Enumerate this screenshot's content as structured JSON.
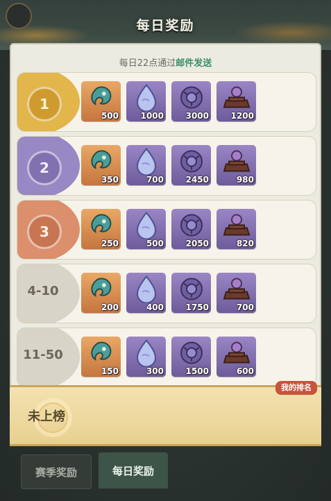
{
  "header": {
    "title": "每日奖励"
  },
  "subtitle": {
    "prefix": "每日22点通过",
    "highlight": "邮件发送"
  },
  "rows": [
    {
      "rank": "1",
      "color": "#e2b64b",
      "qty": [
        "500",
        "1000",
        "3000",
        "1200"
      ]
    },
    {
      "rank": "2",
      "color": "#9888c3",
      "qty": [
        "350",
        "700",
        "2450",
        "980"
      ]
    },
    {
      "rank": "3",
      "color": "#db8f6c",
      "qty": [
        "250",
        "500",
        "2050",
        "820"
      ]
    },
    {
      "rank": "4-10",
      "color": "#d8d4c7",
      "qty": [
        "200",
        "400",
        "1750",
        "700"
      ]
    },
    {
      "rank": "11-50",
      "color": "#d8d4c7",
      "qty": [
        "150",
        "300",
        "1500",
        "600"
      ]
    }
  ],
  "item_icons": [
    "teal-spirit-icon",
    "blue-gem-icon",
    "purple-medallion-icon",
    "pedestal-orb-icon"
  ],
  "my_rank": {
    "tag": "我的排名",
    "label": "未上榜"
  },
  "tabs": [
    {
      "label": "赛季奖励",
      "active": false
    },
    {
      "label": "每日奖励",
      "active": true
    }
  ],
  "colors": {
    "accent_green": "#3f8d6b",
    "tag_red": "#c7543b"
  }
}
